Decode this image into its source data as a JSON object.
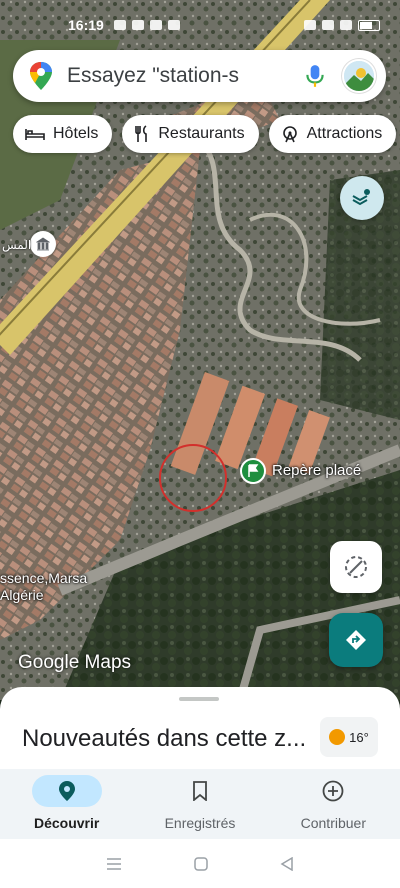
{
  "status_bar": {
    "time": "16:19"
  },
  "search": {
    "placeholder": "Essayez \"station-s"
  },
  "chips": [
    {
      "label": "Hôtels",
      "icon": "bed-icon"
    },
    {
      "label": "Restaurants",
      "icon": "fork-knife-icon"
    },
    {
      "label": "Attractions",
      "icon": "ferris-wheel-icon"
    }
  ],
  "map": {
    "poi_label": "المس",
    "marker_label": "Repère placé",
    "place_label_line1": "ssence,Marsa",
    "place_label_line2": "Algérie",
    "logo_text": "Google Maps"
  },
  "sheet": {
    "title": "Nouveautés dans cette z...",
    "temperature": "16°"
  },
  "bottom_nav": [
    {
      "label": "Découvrir",
      "icon": "location-pin-icon",
      "active": true
    },
    {
      "label": "Enregistrés",
      "icon": "bookmark-icon",
      "active": false
    },
    {
      "label": "Contribuer",
      "icon": "add-circle-icon",
      "active": false
    }
  ],
  "colors": {
    "accent": "#c2e7ff",
    "directions": "#0b7c7d",
    "marker": "#1e8e3e",
    "road": "#d8c46a"
  }
}
